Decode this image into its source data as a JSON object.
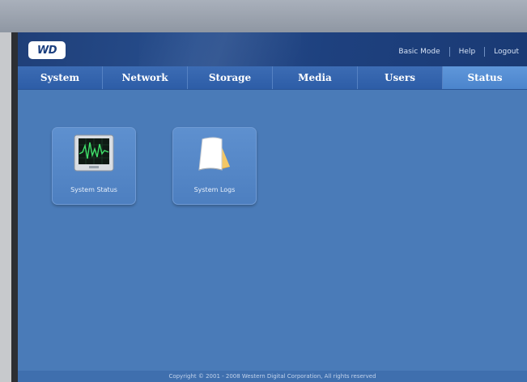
{
  "header": {
    "logo_text": "WD",
    "links": [
      "Basic Mode",
      "Help",
      "Logout"
    ]
  },
  "nav": {
    "tabs": [
      "System",
      "Network",
      "Storage",
      "Media",
      "Users",
      "Status"
    ],
    "active": "Status"
  },
  "tiles": [
    {
      "label": "System Status",
      "icon": "monitor-icon"
    },
    {
      "label": "System Logs",
      "icon": "notepad-icon"
    }
  ],
  "footer": {
    "copyright": "Copyright © 2001 - 2008 Western Digital Corporation, All rights reserved"
  },
  "colors": {
    "panel": "#4a7bb8",
    "header": "#1f3f78",
    "active_tab": "#5f97da"
  }
}
